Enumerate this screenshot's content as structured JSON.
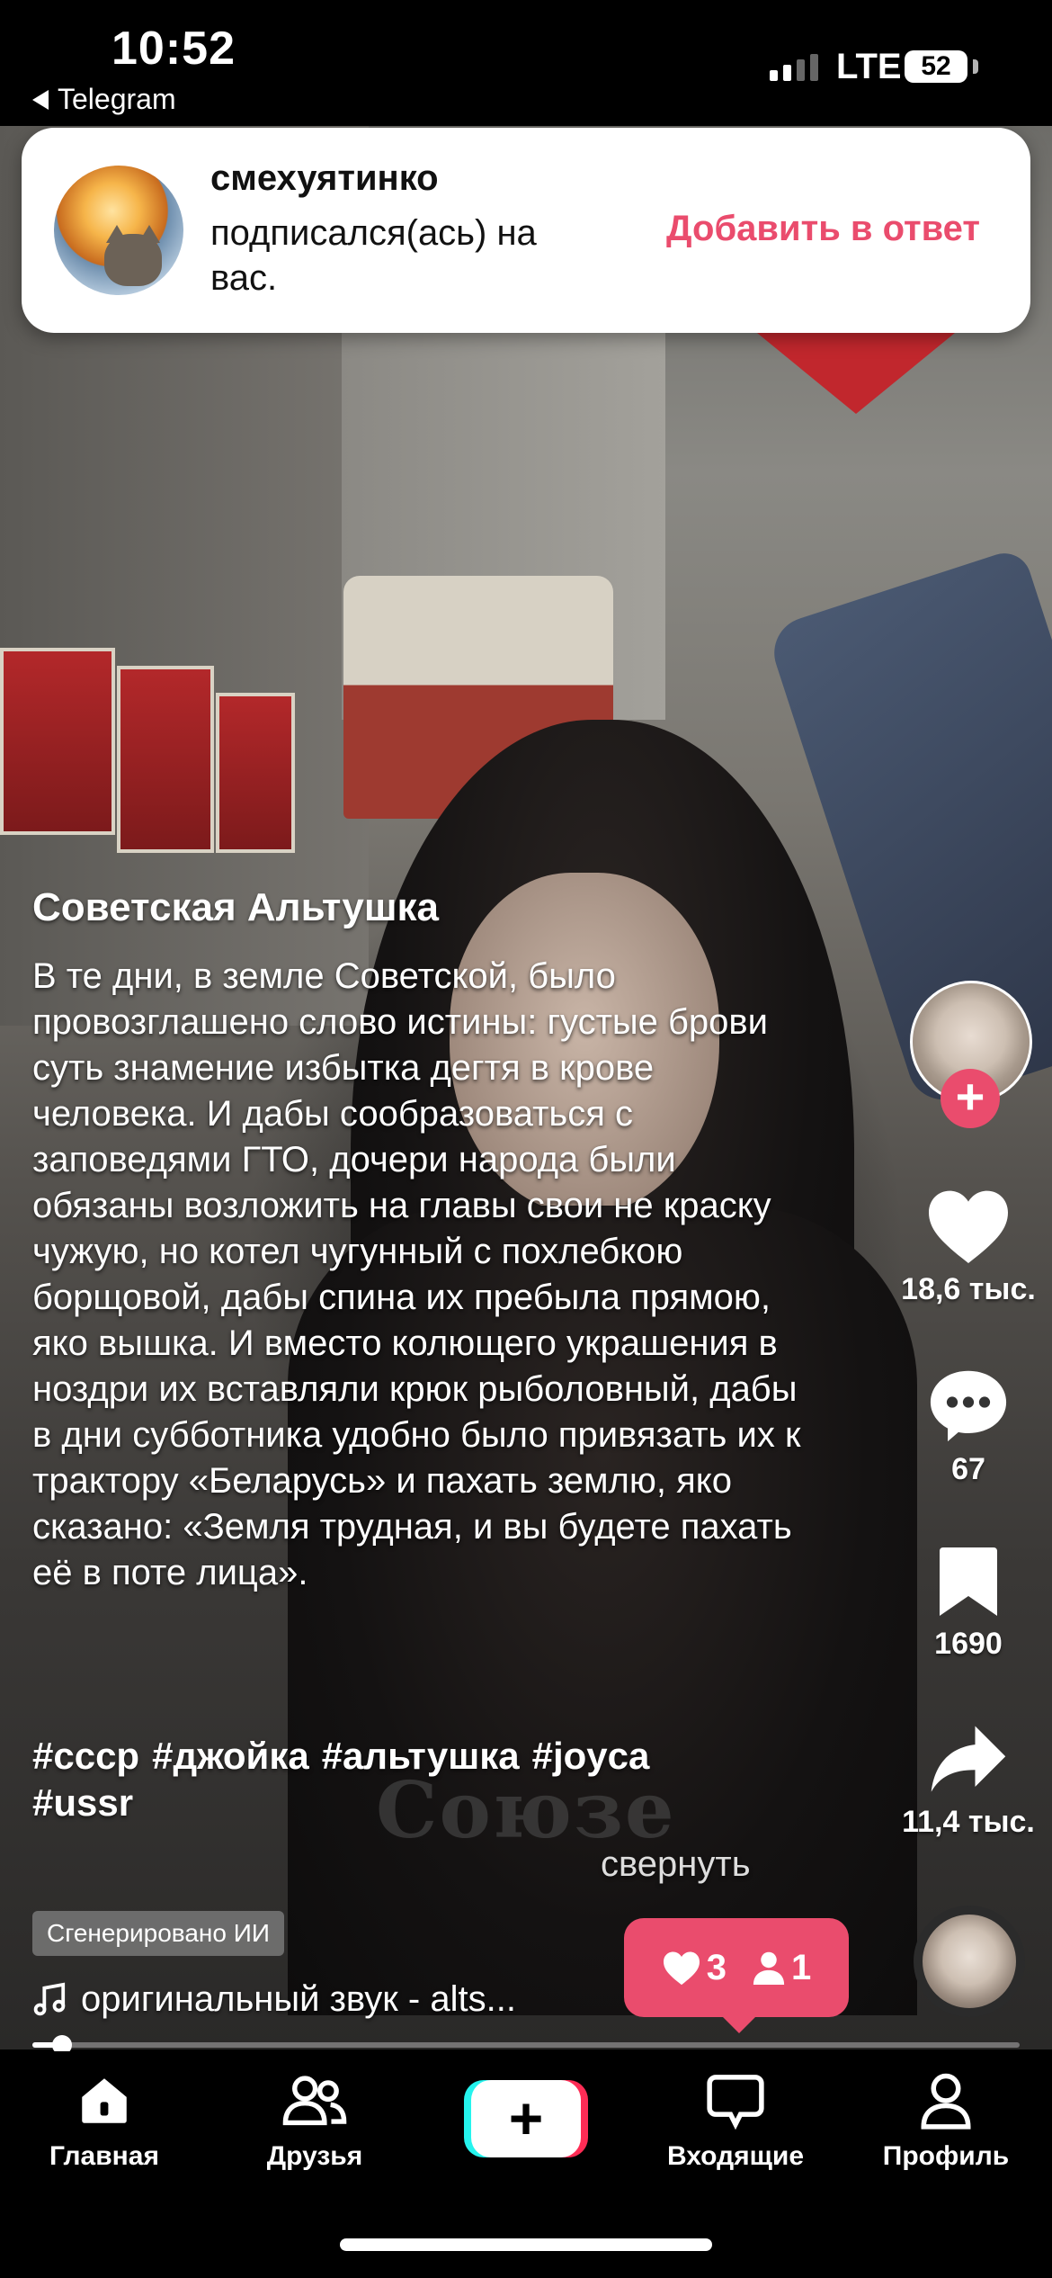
{
  "status_bar": {
    "time": "10:52",
    "back_app": "Telegram",
    "network": "LTE",
    "battery": "52"
  },
  "notification": {
    "username": "смехуятинко",
    "message": "подписался(ась) на вас.",
    "action": "Добавить в ответ"
  },
  "video": {
    "shirt_text": "Союзе"
  },
  "caption": {
    "title": "Советская Альтушка",
    "body": "В те дни, в земле Советской, было провозглашено слово истины: густые брови суть знамение избытка дегтя в крове человека. И дабы сообразоваться с заповедями ГТО, дочери народа были обязаны возложить на главы свои не краску чужую, но котел чугунный с похлебкою борщовой, дабы спина их пребыла прямою, яко вышка. И вместо колющего украшения в ноздри их вставляли крюк рыболовный, дабы в дни субботника удобно было привязать их к трактору «Беларусь» и пахать землю, яко сказано: «Земля трудная, и вы будете пахать её в поте лица».",
    "hashtags": [
      "#ссср",
      "#джойка",
      "#альтушка",
      "#joyca",
      "#ussr"
    ],
    "collapse": "свернуть"
  },
  "actions": {
    "likes": "18,6 тыс.",
    "comments": "67",
    "saves": "1690",
    "shares": "11,4 тыс."
  },
  "ai_badge": "Сгенерировано ИИ",
  "sound": {
    "title": "оригинальный звук - alts..."
  },
  "activity_popup": {
    "likes": "3",
    "followers": "1"
  },
  "progress": {
    "fraction": 0.03
  },
  "nav": {
    "home": "Главная",
    "friends": "Друзья",
    "inbox": "Входящие",
    "profile": "Профиль"
  },
  "colors": {
    "accent": "#ea4c6d",
    "nav_bg": "#000000"
  }
}
